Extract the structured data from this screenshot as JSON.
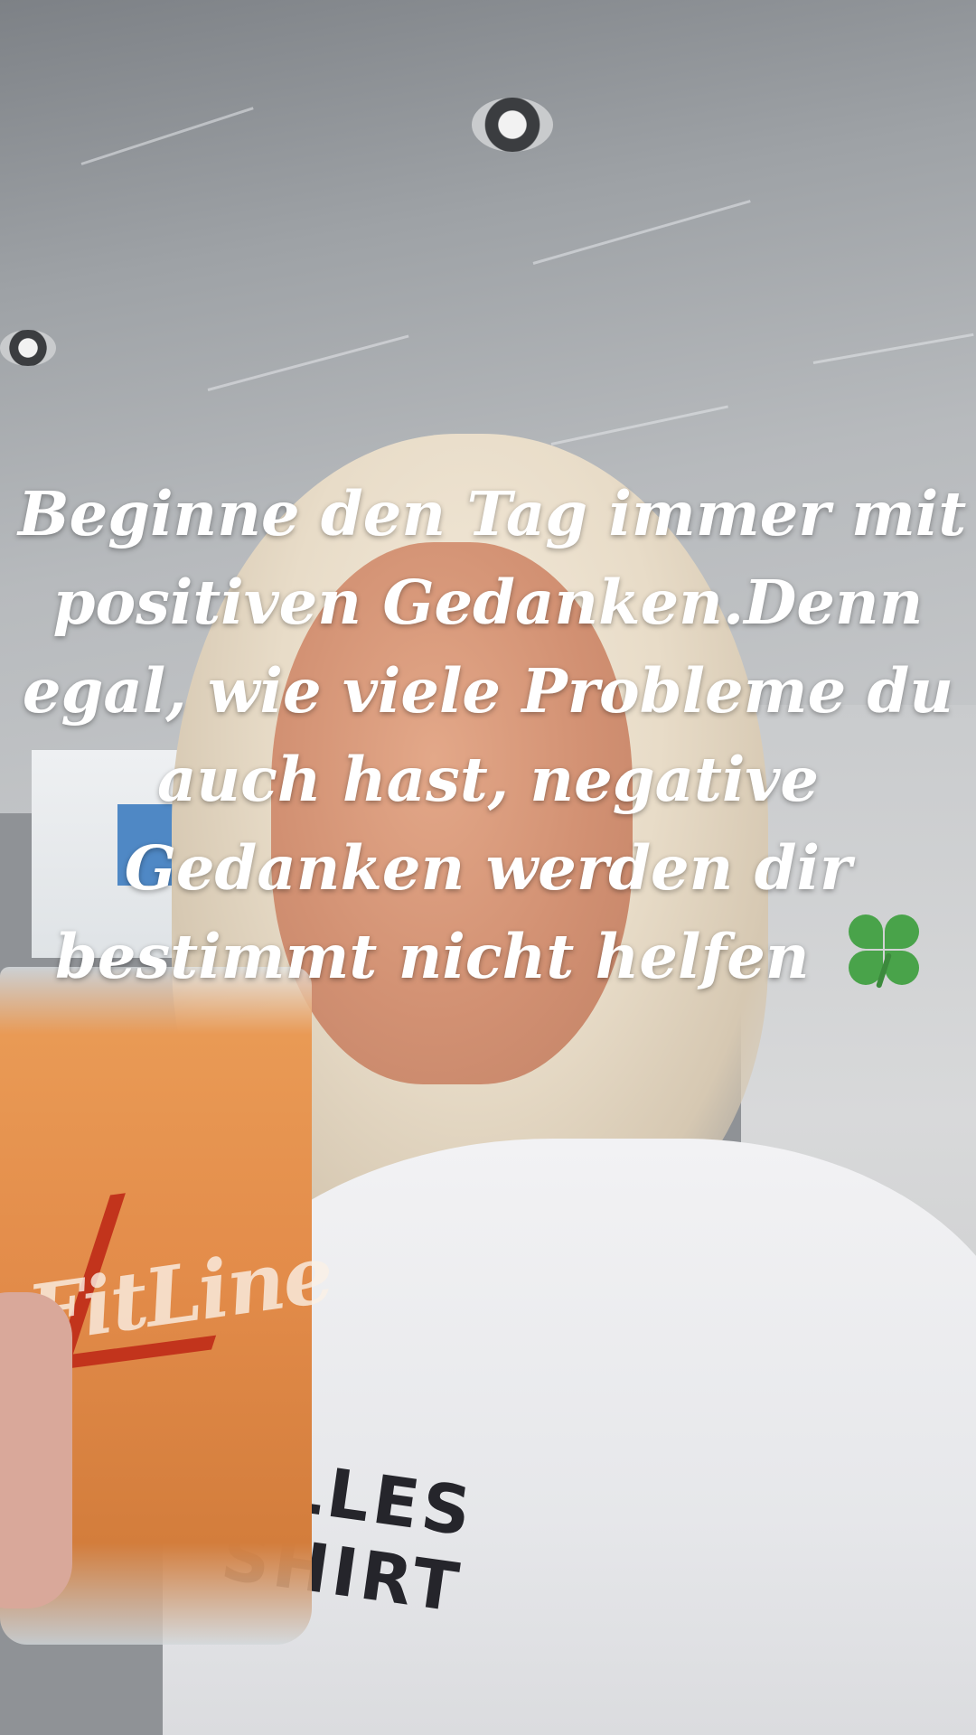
{
  "story": {
    "caption_lines": [
      "Beginne den Tag immer mit",
      "positiven Gedanken.Denn",
      "egal, wie viele Probleme du",
      "auch hast, negative",
      "Gedanken werden dir",
      "bestimmt nicht helfen"
    ],
    "caption_emoji": "four-leaf-clover",
    "glass_logo_text": "FitLine",
    "shirt_print_lines": [
      "ELLES",
      "SHIRT"
    ]
  },
  "colors": {
    "caption_text": "#ffffff",
    "juice": "#e38c4a",
    "clover": "#49a34a",
    "logo_accent": "#c2341c"
  }
}
